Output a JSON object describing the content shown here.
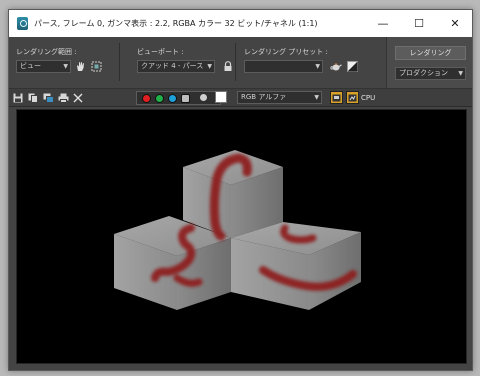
{
  "window": {
    "title": "パース, フレーム 0, ガンマ表示 : 2.2, RGBA カラー 32 ビット/チャネル (1:1)",
    "controls": {
      "minimize": "—",
      "maximize": "☐",
      "close": "✕"
    }
  },
  "toolbar": {
    "render_area_label": "レンダリング範囲 :",
    "render_area_value": "ビュー",
    "viewport_label": "ビューポート :",
    "viewport_value": "クアッド 4 - パース",
    "preset_label": "レンダリング プリセット :",
    "preset_value": "",
    "render_button": "レンダリング",
    "production_value": "プロダクション"
  },
  "toolbar2": {
    "channel_display_value": "RGB アルファ",
    "processor_label": "CPU",
    "channels": [
      "red",
      "green",
      "blue",
      "alpha"
    ]
  },
  "icons": [
    "save-icon",
    "copy-icon",
    "clone-icon",
    "print-icon",
    "clear-icon",
    "hand-icon",
    "region-icon",
    "lock-icon",
    "teapot-icon",
    "environment-icon"
  ],
  "colors": {
    "window_bg": "#444444",
    "viewport_bg": "#000000",
    "cube_face_light": "#9a9a9a",
    "cube_face_dark": "#7a7a7a",
    "paint_stroke": "#8e1c1c",
    "channel_red": "#e02020",
    "channel_green": "#22b04a",
    "channel_blue": "#1fa0d8"
  }
}
